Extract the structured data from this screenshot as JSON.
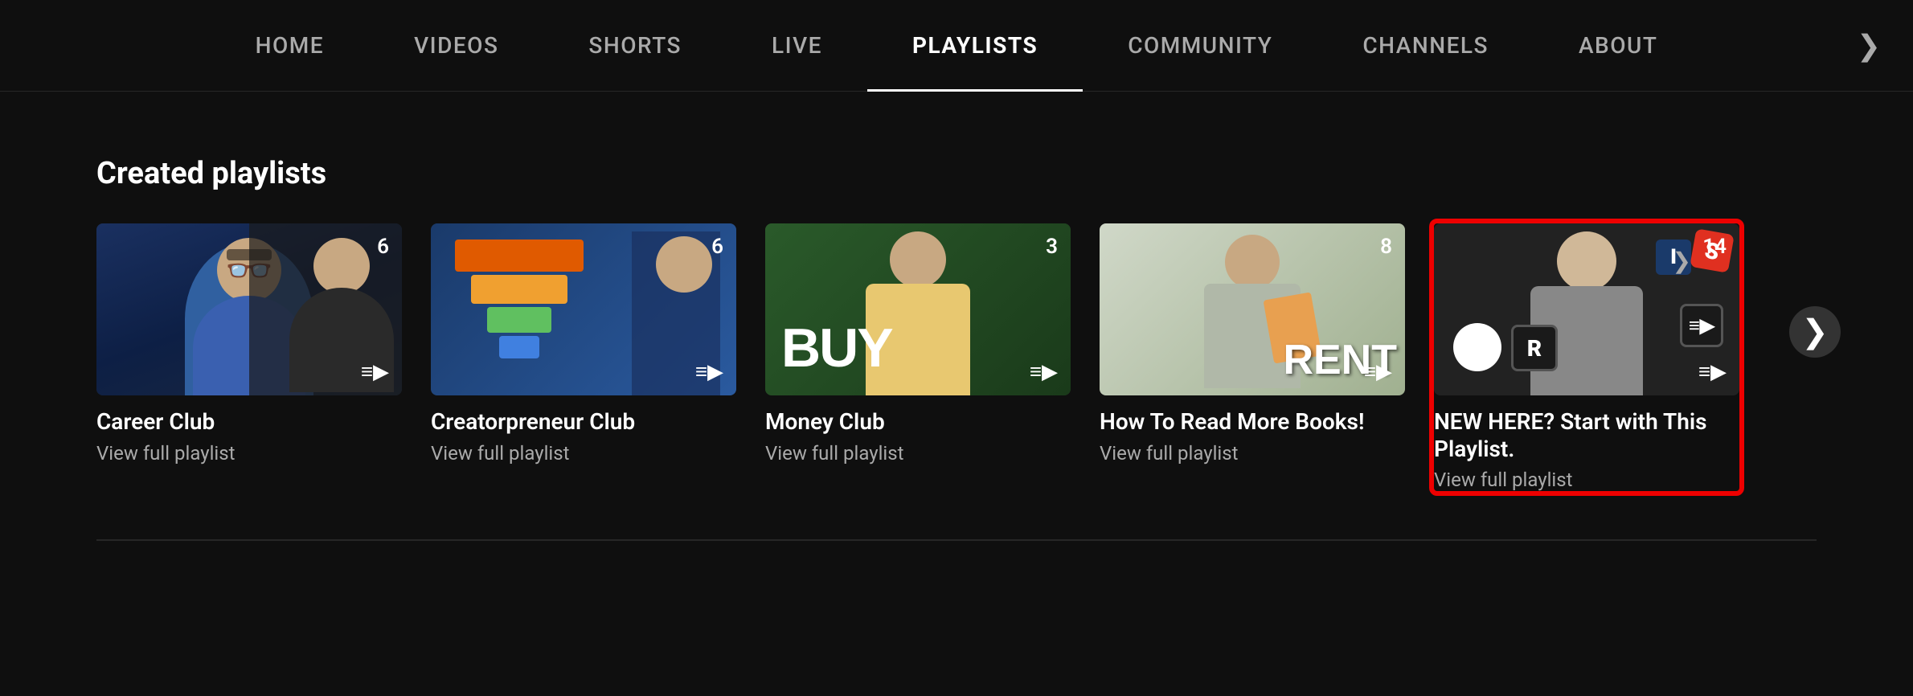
{
  "nav": {
    "items": [
      {
        "id": "home",
        "label": "HOME",
        "active": false
      },
      {
        "id": "videos",
        "label": "VIDEOS",
        "active": false
      },
      {
        "id": "shorts",
        "label": "SHORTS",
        "active": false
      },
      {
        "id": "live",
        "label": "LIVE",
        "active": false
      },
      {
        "id": "playlists",
        "label": "PLAYLISTS",
        "active": true
      },
      {
        "id": "community",
        "label": "COMMUNITY",
        "active": false
      },
      {
        "id": "channels",
        "label": "CHANNELS",
        "active": false
      },
      {
        "id": "about",
        "label": "ABOUT",
        "active": false
      }
    ],
    "more_arrow": "❯"
  },
  "section": {
    "title": "Created playlists"
  },
  "playlists": [
    {
      "id": "career-club",
      "name": "Career Club",
      "sub": "View full playlist",
      "count": "6",
      "highlighted": false,
      "color": "career"
    },
    {
      "id": "creatorpreneur-club",
      "name": "Creatorpreneur Club",
      "sub": "View full playlist",
      "count": "6",
      "highlighted": false,
      "color": "creator"
    },
    {
      "id": "money-club",
      "name": "Money Club",
      "sub": "View full playlist",
      "count": "3",
      "highlighted": false,
      "color": "money"
    },
    {
      "id": "how-to-read",
      "name": "How To Read More Books!",
      "sub": "View full playlist",
      "count": "8",
      "highlighted": false,
      "color": "books"
    },
    {
      "id": "new-here",
      "name": "NEW HERE? Start with This Playlist.",
      "sub": "View full playlist",
      "count": "14",
      "highlighted": true,
      "color": "new"
    }
  ]
}
